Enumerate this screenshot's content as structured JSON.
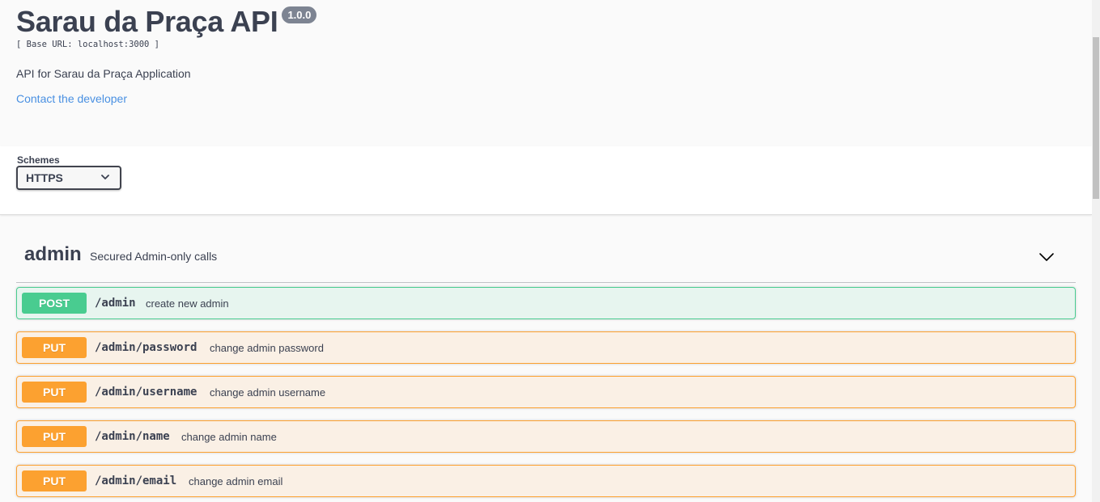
{
  "info": {
    "title": "Sarau da Praça API",
    "version": "1.0.0",
    "base_url": "[ Base URL: localhost:3000 ]",
    "description": "API for Sarau da Praça Application",
    "contact_label": "Contact the developer"
  },
  "schemes": {
    "label": "Schemes",
    "selected": "HTTPS"
  },
  "tag": {
    "name": "admin",
    "description": "Secured Admin-only calls",
    "toggle_icon": "chevron-down-icon"
  },
  "operations": [
    {
      "method": "POST",
      "path": "/admin",
      "summary": "create new admin"
    },
    {
      "method": "PUT",
      "path": "/admin/password",
      "summary": "change admin password"
    },
    {
      "method": "PUT",
      "path": "/admin/username",
      "summary": "change admin username"
    },
    {
      "method": "PUT",
      "path": "/admin/name",
      "summary": "change admin name"
    },
    {
      "method": "PUT",
      "path": "/admin/email",
      "summary": "change admin email"
    }
  ],
  "colors": {
    "post": "#49cc90",
    "put": "#fca130",
    "link": "#4990e2",
    "text": "#3b4151",
    "badge": "#7d8492"
  }
}
